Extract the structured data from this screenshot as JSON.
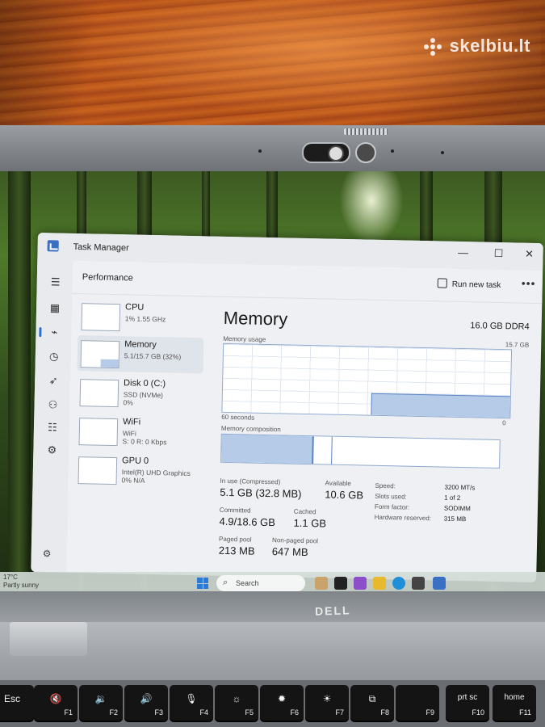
{
  "watermark": "skelbiu.lt",
  "task_manager": {
    "title": "Task Manager",
    "window_controls": {
      "minimize": "—",
      "maximize": "☐",
      "close": "✕"
    },
    "section_title": "Performance",
    "run_new_task": "Run new task",
    "more": "•••"
  },
  "nav_icons": [
    "menu-icon",
    "processes-icon",
    "performance-icon",
    "app-history-icon",
    "startup-icon",
    "users-icon",
    "details-icon",
    "services-icon",
    "settings-icon"
  ],
  "devices": [
    {
      "name": "CPU",
      "line1": "1%  1.55 GHz",
      "line2": ""
    },
    {
      "name": "Memory",
      "line1": "5.1/15.7 GB (32%)",
      "line2": ""
    },
    {
      "name": "Disk 0 (C:)",
      "line1": "SSD (NVMe)",
      "line2": "0%"
    },
    {
      "name": "WiFi",
      "line1": "WiFi",
      "line2": "S: 0  R: 0 Kbps"
    },
    {
      "name": "GPU 0",
      "line1": "Intel(R) UHD Graphics",
      "line2": "0%  N/A"
    }
  ],
  "memory": {
    "title": "Memory",
    "spec": "16.0 GB DDR4",
    "usage_label": "Memory usage",
    "usage_max": "15.7 GB",
    "time_left": "60 seconds",
    "time_right": "0",
    "composition_label": "Memory composition",
    "in_use_label": "In use (Compressed)",
    "in_use_value": "5.1 GB (32.8 MB)",
    "available_label": "Available",
    "available_value": "10.6 GB",
    "committed_label": "Committed",
    "committed_value": "4.9/18.6 GB",
    "cached_label": "Cached",
    "cached_value": "1.1 GB",
    "paged_label": "Paged pool",
    "paged_value": "213 MB",
    "nonpaged_label": "Non-paged pool",
    "nonpaged_value": "647 MB",
    "details": [
      {
        "k": "Speed:",
        "v": "3200 MT/s"
      },
      {
        "k": "Slots used:",
        "v": "1 of 2"
      },
      {
        "k": "Form factor:",
        "v": "SODIMM"
      },
      {
        "k": "Hardware reserved:",
        "v": "315 MB"
      }
    ]
  },
  "taskbar": {
    "temp": "17°C",
    "weather": "Partly sunny",
    "search_placeholder": "Search"
  },
  "laptop_brand": "DELL",
  "keys": [
    {
      "label": "Esc",
      "fn": ""
    },
    {
      "label": "🔇",
      "fn": "F1"
    },
    {
      "label": "🔉",
      "fn": "F2"
    },
    {
      "label": "🔊",
      "fn": "F3"
    },
    {
      "label": "🎙",
      "fn": "F4"
    },
    {
      "label": "☼",
      "fn": "F5"
    },
    {
      "label": "✹",
      "fn": "F6"
    },
    {
      "label": "☀",
      "fn": "F7"
    },
    {
      "label": "⧉",
      "fn": "F8"
    },
    {
      "label": "",
      "fn": "F9"
    },
    {
      "label": "prt sc",
      "fn": "F10"
    },
    {
      "label": "home",
      "fn": "F11"
    }
  ],
  "colors": {
    "accent": "#2f6fd0",
    "memory_fill": "#b6cbe8",
    "memory_line": "#5b86c5"
  }
}
